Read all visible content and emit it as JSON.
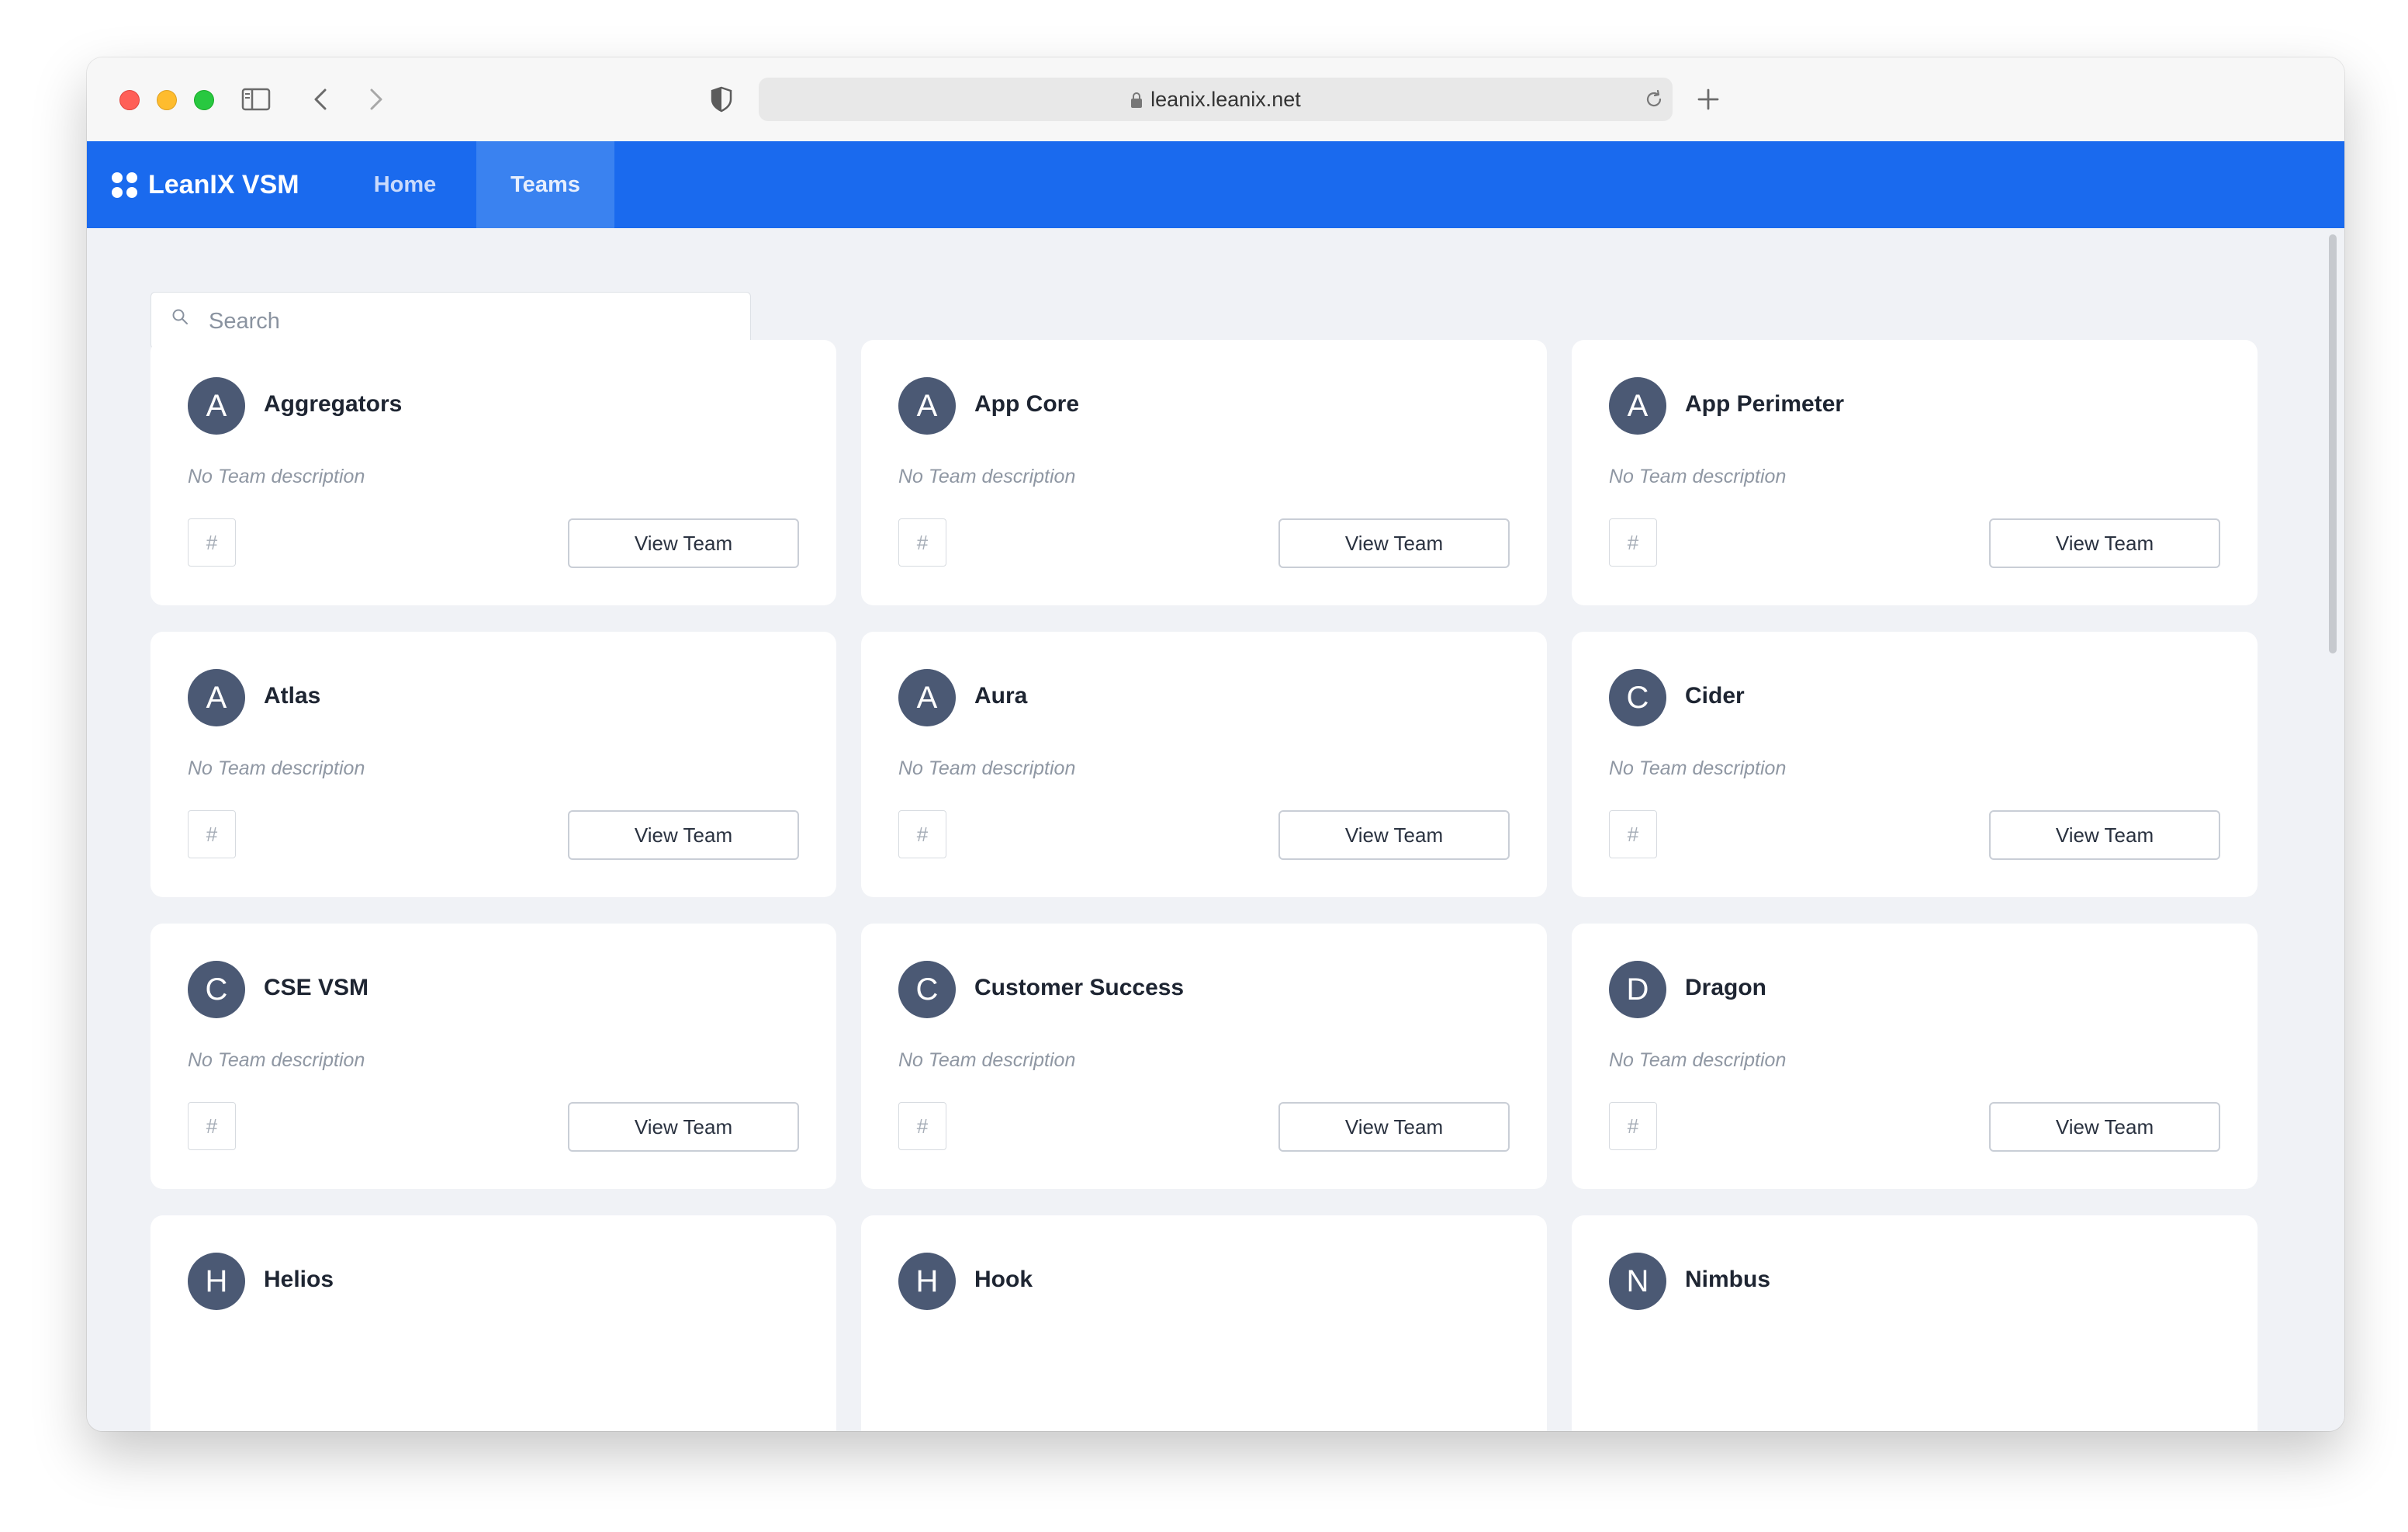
{
  "browser": {
    "url": "leanix.leanix.net"
  },
  "navbar": {
    "brand": "LeanIX VSM",
    "items": [
      {
        "label": "Home",
        "active": false
      },
      {
        "label": "Teams",
        "active": true
      }
    ]
  },
  "search": {
    "placeholder": "Search",
    "value": ""
  },
  "teams": [
    {
      "initial": "A",
      "name": "Aggregators",
      "description": "No Team description",
      "tag": "#",
      "action": "View Team"
    },
    {
      "initial": "A",
      "name": "App Core",
      "description": "No Team description",
      "tag": "#",
      "action": "View Team"
    },
    {
      "initial": "A",
      "name": "App Perimeter",
      "description": "No Team description",
      "tag": "#",
      "action": "View Team"
    },
    {
      "initial": "A",
      "name": "Atlas",
      "description": "No Team description",
      "tag": "#",
      "action": "View Team"
    },
    {
      "initial": "A",
      "name": "Aura",
      "description": "No Team description",
      "tag": "#",
      "action": "View Team"
    },
    {
      "initial": "C",
      "name": "Cider",
      "description": "No Team description",
      "tag": "#",
      "action": "View Team"
    },
    {
      "initial": "C",
      "name": "CSE VSM",
      "description": "No Team description",
      "tag": "#",
      "action": "View Team"
    },
    {
      "initial": "C",
      "name": "Customer Success",
      "description": "No Team description",
      "tag": "#",
      "action": "View Team"
    },
    {
      "initial": "D",
      "name": "Dragon",
      "description": "No Team description",
      "tag": "#",
      "action": "View Team"
    },
    {
      "initial": "H",
      "name": "Helios"
    },
    {
      "initial": "H",
      "name": "Hook"
    },
    {
      "initial": "N",
      "name": "Nimbus"
    }
  ],
  "colors": {
    "navbar": "#1a6aee",
    "active_tab": "#3a82f0",
    "avatar": "#4b5974",
    "page_background": "#f0f2f6"
  }
}
